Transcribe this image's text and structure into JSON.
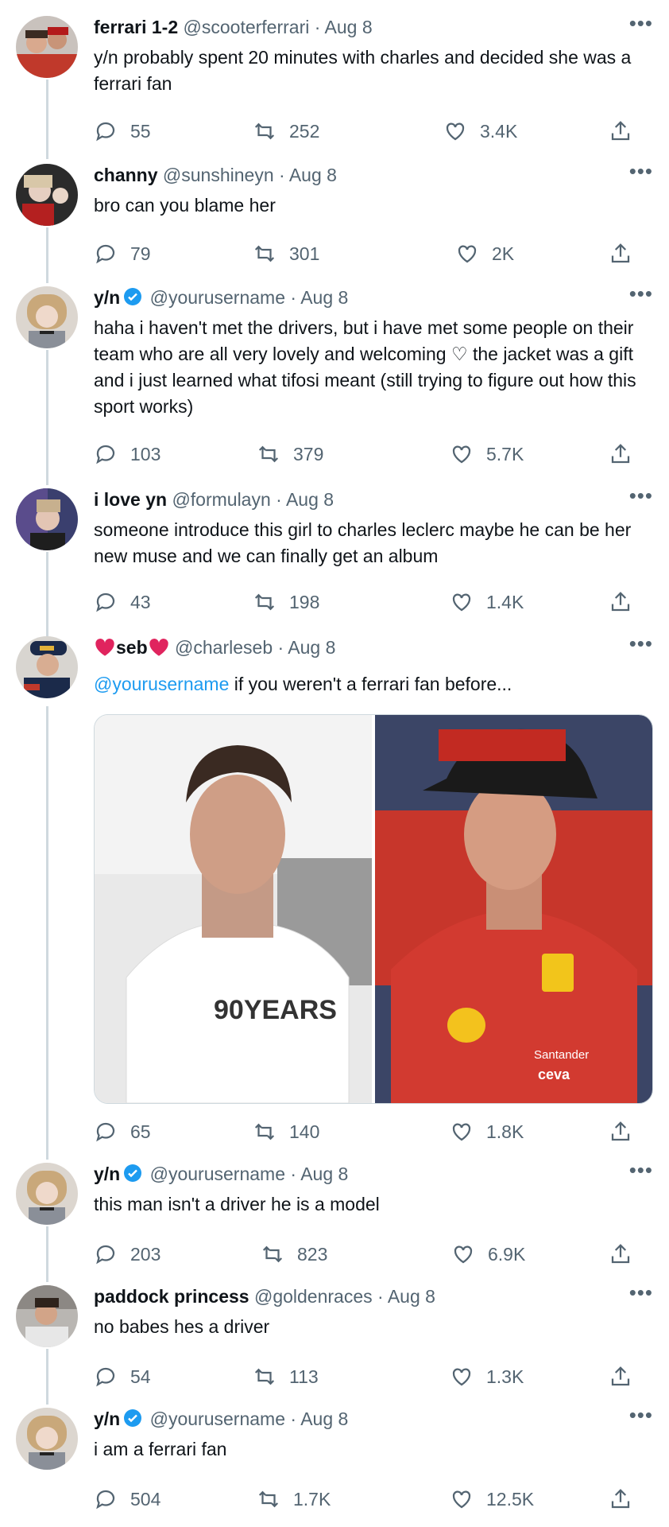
{
  "tweets": [
    {
      "name": "ferrari 1-2",
      "handle": "@scooterferrari",
      "date": "Aug 8",
      "text": "y/n probably spent 20 minutes with charles and decided she was a ferrari fan",
      "replies": "55",
      "retweets": "252",
      "likes": "3.4K"
    },
    {
      "name": "channy",
      "handle": "@sunshineyn",
      "date": "Aug 8",
      "text": "bro can you blame her",
      "replies": "79",
      "retweets": "301",
      "likes": "2K"
    },
    {
      "name": "y/n",
      "handle": "@yourusername",
      "date": "Aug 8",
      "text": "haha i haven't met the drivers, but i have met some people on their team who are all very lovely and welcoming ♡ the jacket was a gift and i just learned what tifosi meant (still trying to figure out how this sport works)",
      "replies": "103",
      "retweets": "379",
      "likes": "5.7K"
    },
    {
      "name": "i love yn",
      "handle": "@formulayn",
      "date": "Aug 8",
      "text": "someone introduce this girl to charles leclerc maybe he can be her new muse and we can finally get an album",
      "replies": "43",
      "retweets": "198",
      "likes": "1.4K"
    },
    {
      "name": "seb",
      "handle": "@charleseb",
      "date": "Aug 8",
      "mention": "@yourusername",
      "text": " if you weren't a ferrari fan before...",
      "replies": "65",
      "retweets": "140",
      "likes": "1.8K",
      "image_left_text": "90YEARS",
      "image_right_sponsors": [
        "Santander",
        "ceva"
      ]
    },
    {
      "name": "y/n",
      "handle": "@yourusername",
      "date": "Aug 8",
      "text": "this man isn't a driver he is a model",
      "replies": "203",
      "retweets": "823",
      "likes": "6.9K"
    },
    {
      "name": "paddock princess",
      "handle": "@goldenraces",
      "date": "Aug 8",
      "text": "no babes hes a driver",
      "replies": "54",
      "retweets": "113",
      "likes": "1.3K"
    },
    {
      "name": "y/n",
      "handle": "@yourusername",
      "date": "Aug 8",
      "text": "i am a ferrari fan",
      "replies": "504",
      "retweets": "1.7K",
      "likes": "12.5K"
    }
  ],
  "separator": "·",
  "more_label": "•••",
  "colors": {
    "link": "#1d9bf0",
    "muted": "#536471",
    "thread": "#cfd9de",
    "heart": "#e0245e"
  },
  "icons": [
    "reply-icon",
    "retweet-icon",
    "like-icon",
    "share-icon",
    "verified-icon",
    "more-icon"
  ]
}
